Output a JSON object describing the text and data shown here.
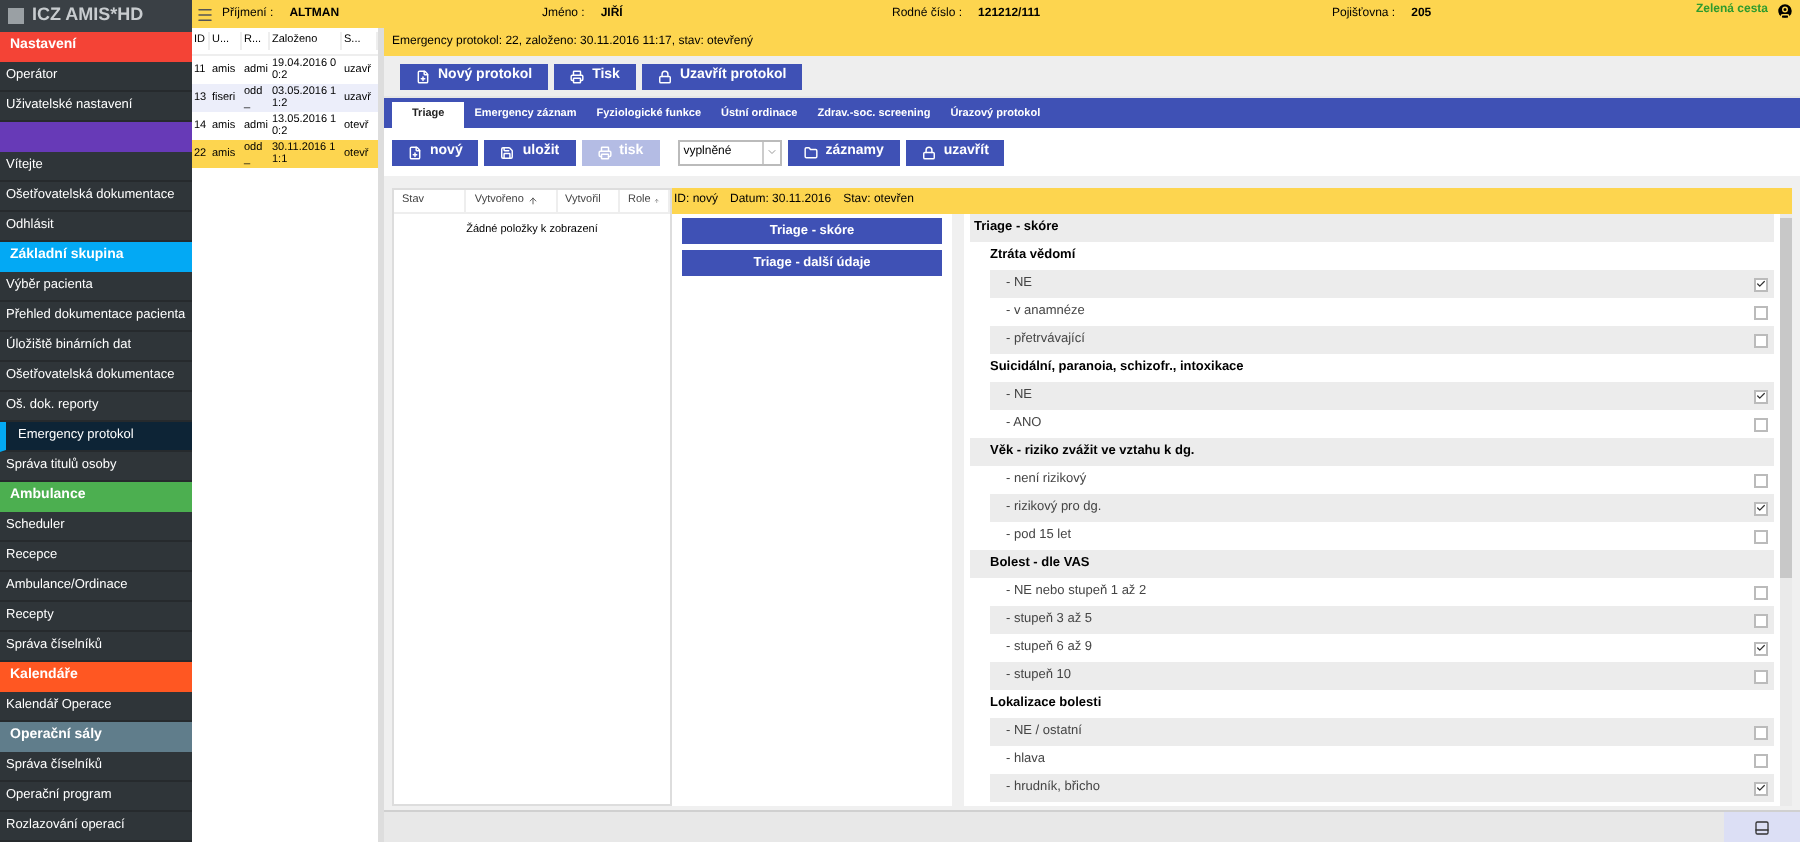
{
  "logo": "ICZ AMIS*HD",
  "sidebar": [
    {
      "kind": "header",
      "label": "Nastavení",
      "color": "#f44336"
    },
    {
      "kind": "item",
      "label": "Operátor",
      "selected": false
    },
    {
      "kind": "item",
      "label": "Uživatelské nastavení",
      "selected": false
    },
    {
      "kind": "header",
      "color": "#673ab7"
    },
    {
      "kind": "item",
      "label": "Vítejte",
      "selected": false
    },
    {
      "kind": "item",
      "label": "Ošetřovatelská dokumentace",
      "selected": false
    },
    {
      "kind": "item",
      "label": "Odhlásit",
      "selected": false
    },
    {
      "kind": "header",
      "label": "Základní skupina",
      "color": "#03a9f4"
    },
    {
      "kind": "item",
      "label": "Výběr pacienta",
      "selected": false
    },
    {
      "kind": "item",
      "label": "Přehled dokumentace pacienta",
      "selected": false
    },
    {
      "kind": "item",
      "label": "Úložiště binárních dat",
      "selected": false
    },
    {
      "kind": "item",
      "label": "Ošetřovatelská dokumentace",
      "selected": false
    },
    {
      "kind": "item",
      "label": "Oš. dok. reporty",
      "selected": false
    },
    {
      "kind": "item",
      "label": "Emergency protokol",
      "selected": true
    },
    {
      "kind": "item",
      "label": "Správa titulů osoby",
      "selected": false
    },
    {
      "kind": "header",
      "label": "Ambulance",
      "color": "#4caf50"
    },
    {
      "kind": "item",
      "label": "Scheduler",
      "selected": false
    },
    {
      "kind": "item",
      "label": "Recepce",
      "selected": false
    },
    {
      "kind": "item",
      "label": "Ambulance/Ordinace",
      "selected": false
    },
    {
      "kind": "item",
      "label": "Recepty",
      "selected": false
    },
    {
      "kind": "item",
      "label": "Správa číselníků",
      "selected": false
    },
    {
      "kind": "header",
      "label": "Kalendáře",
      "color": "#ff5722"
    },
    {
      "kind": "item",
      "label": "Kalendář Operace",
      "selected": false
    },
    {
      "kind": "header",
      "label": "Operační sály",
      "color": "#607d8b"
    },
    {
      "kind": "item",
      "label": "Správa číselníků",
      "selected": false
    },
    {
      "kind": "item",
      "label": "Operační program",
      "selected": false
    },
    {
      "kind": "item",
      "label": "Rozlazování operací",
      "selected": false
    }
  ],
  "patient": [
    {
      "label": "Příjmení :",
      "value": "ALTMAN"
    },
    {
      "label": "Jméno :",
      "value": "JIŘÍ"
    },
    {
      "label": "Rodné číslo :",
      "value": "121212/111"
    },
    {
      "label": "Pojišťovna :",
      "value": "205"
    }
  ],
  "patient_status": "Zelená cesta",
  "records": {
    "columns": [
      "ID",
      "U...",
      "R...",
      "Založeno",
      "S..."
    ],
    "rows": [
      {
        "cells": [
          "11",
          "amis",
          "admi",
          "19.04.2016 00:2",
          "uzavř"
        ],
        "selected": false
      },
      {
        "cells": [
          "13",
          "fiseri",
          "odd_",
          "03.05.2016 11:2",
          "uzavř"
        ],
        "selected": false
      },
      {
        "cells": [
          "14",
          "amis",
          "admi",
          "13.05.2016 10:2",
          "otevř"
        ],
        "selected": false
      },
      {
        "cells": [
          "22",
          "amis",
          "odd_",
          "30.11.2016 11:1",
          "otevř"
        ],
        "selected": true
      }
    ]
  },
  "protocol_info": "Emergency protokol: 22, založeno: 30.11.2016 11:17, stav: otevřený",
  "actions": [
    {
      "label": "Nový protokol",
      "kind": "new"
    },
    {
      "label": "Tisk",
      "kind": "print"
    },
    {
      "label": "Uzavřít protokol",
      "kind": "lock"
    }
  ],
  "tabs": [
    {
      "label": "Triage",
      "selected": true
    },
    {
      "label": "Emergency záznam",
      "selected": false
    },
    {
      "label": "Fyziologické funkce",
      "selected": false
    },
    {
      "label": "Ústní ordinace",
      "selected": false
    },
    {
      "label": "Zdrav.-soc. screening",
      "selected": false
    },
    {
      "label": "Úrazový protokol",
      "selected": false
    }
  ],
  "toolbar": [
    {
      "label": "nový",
      "kind": "new",
      "disabled": false
    },
    {
      "label": "uložit",
      "kind": "save",
      "disabled": false
    },
    {
      "label": "tisk",
      "kind": "print",
      "disabled": true
    },
    {
      "kind": "select",
      "value": "vyplněné"
    },
    {
      "label": "záznamy",
      "kind": "folder",
      "disabled": false
    },
    {
      "label": "uzavřít",
      "kind": "lock",
      "disabled": false
    }
  ],
  "grid": {
    "columns": [
      {
        "label": "Stav",
        "sorted": false
      },
      {
        "label": "Vytvořeno",
        "sorted": true
      },
      {
        "label": "Vytvořil",
        "sorted": false
      },
      {
        "label": "Role",
        "sorted": true
      }
    ],
    "empty": "Žádné položky k zobrazení"
  },
  "info": [
    "ID: nový",
    "Datum: 30.11.2016",
    "Stav: otevřen"
  ],
  "sections": [
    "Triage - skóre",
    "Triage - další údaje"
  ],
  "tree": {
    "title": "Triage - skóre",
    "groups": [
      {
        "title": "Ztráta vědomí",
        "options": [
          {
            "label": "- NE",
            "checked": true
          },
          {
            "label": "- v anamnéze",
            "checked": false
          },
          {
            "label": "- přetrvávající",
            "checked": false
          }
        ]
      },
      {
        "title": "Suicidální, paranoia, schizofr., intoxikace",
        "options": [
          {
            "label": "- NE",
            "checked": true
          },
          {
            "label": "- ANO",
            "checked": false
          }
        ]
      },
      {
        "title": "Věk - riziko zvážit ve vztahu k dg.",
        "options": [
          {
            "label": "- není rizikový",
            "checked": false
          },
          {
            "label": "- rizikový pro dg.",
            "checked": true
          },
          {
            "label": "- pod 15 let",
            "checked": false
          }
        ]
      },
      {
        "title": "Bolest - dle VAS",
        "options": [
          {
            "label": "- NE nebo stupeň 1 až 2",
            "checked": false
          },
          {
            "label": "- stupeň 3 až 5",
            "checked": false
          },
          {
            "label": "- stupeň 6 až 9",
            "checked": true
          },
          {
            "label": "- stupeň 10",
            "checked": false
          }
        ]
      },
      {
        "title": "Lokalizace bolesti",
        "options": [
          {
            "label": "- NE / ostatní",
            "checked": false
          },
          {
            "label": "- hlava",
            "checked": false
          },
          {
            "label": "- hrudník, břicho",
            "checked": true
          }
        ]
      }
    ]
  }
}
